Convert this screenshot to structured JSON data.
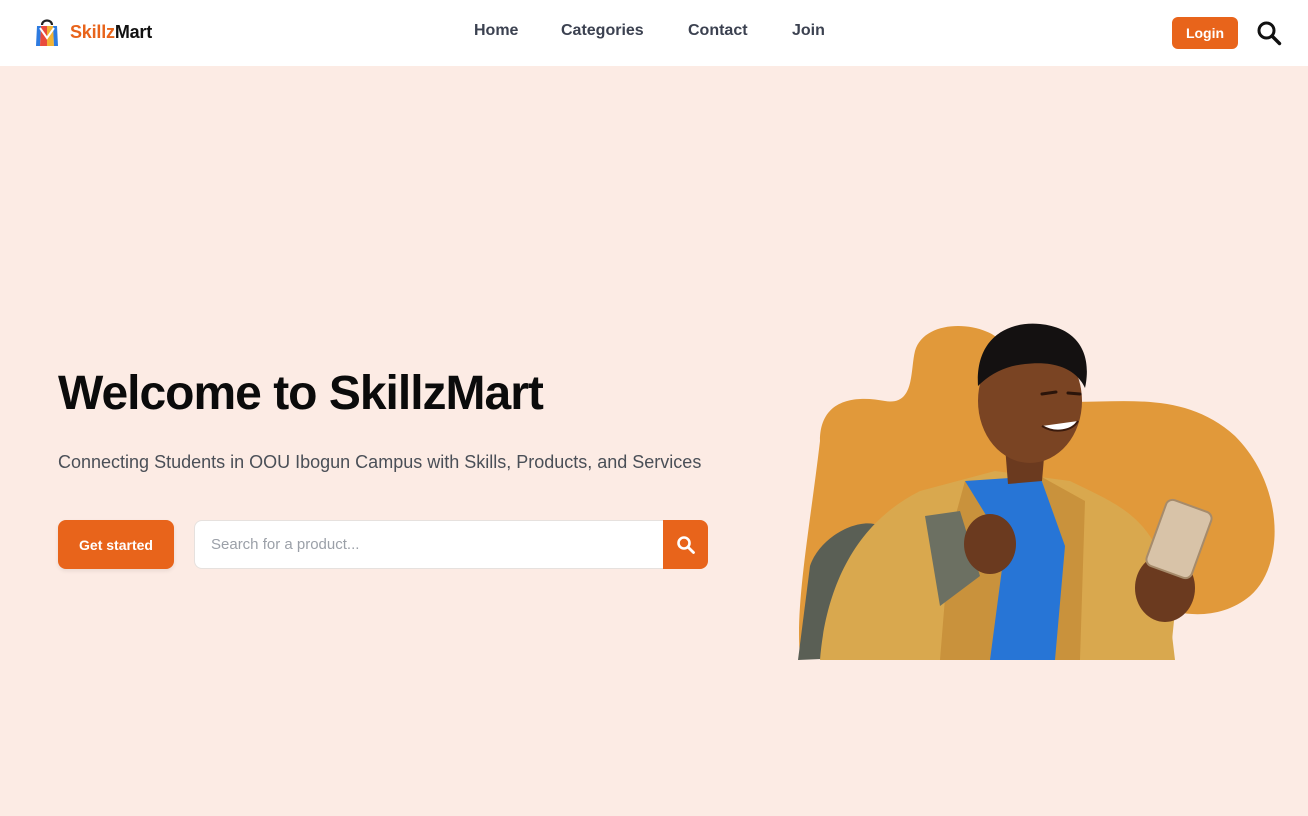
{
  "header": {
    "brand_part1": "Skillz",
    "brand_part2": "Mart",
    "nav": [
      {
        "label": "Home"
      },
      {
        "label": "Categories"
      },
      {
        "label": "Contact"
      },
      {
        "label": "Join"
      }
    ],
    "login_label": "Login",
    "search_icon": "search-icon"
  },
  "hero": {
    "title": "Welcome to SkillzMart",
    "subtitle": "Connecting Students in OOU Ibogun Campus with Skills, Products, and Services",
    "cta_label": "Get started",
    "search_placeholder": "Search for a product...",
    "search_button_icon": "search-icon",
    "image_icon": "student-with-phone-illustration"
  },
  "colors": {
    "accent": "#e8641b",
    "hero_bg": "#fcebe4",
    "blob": "#e1993a",
    "nav_text": "#3b4150"
  }
}
